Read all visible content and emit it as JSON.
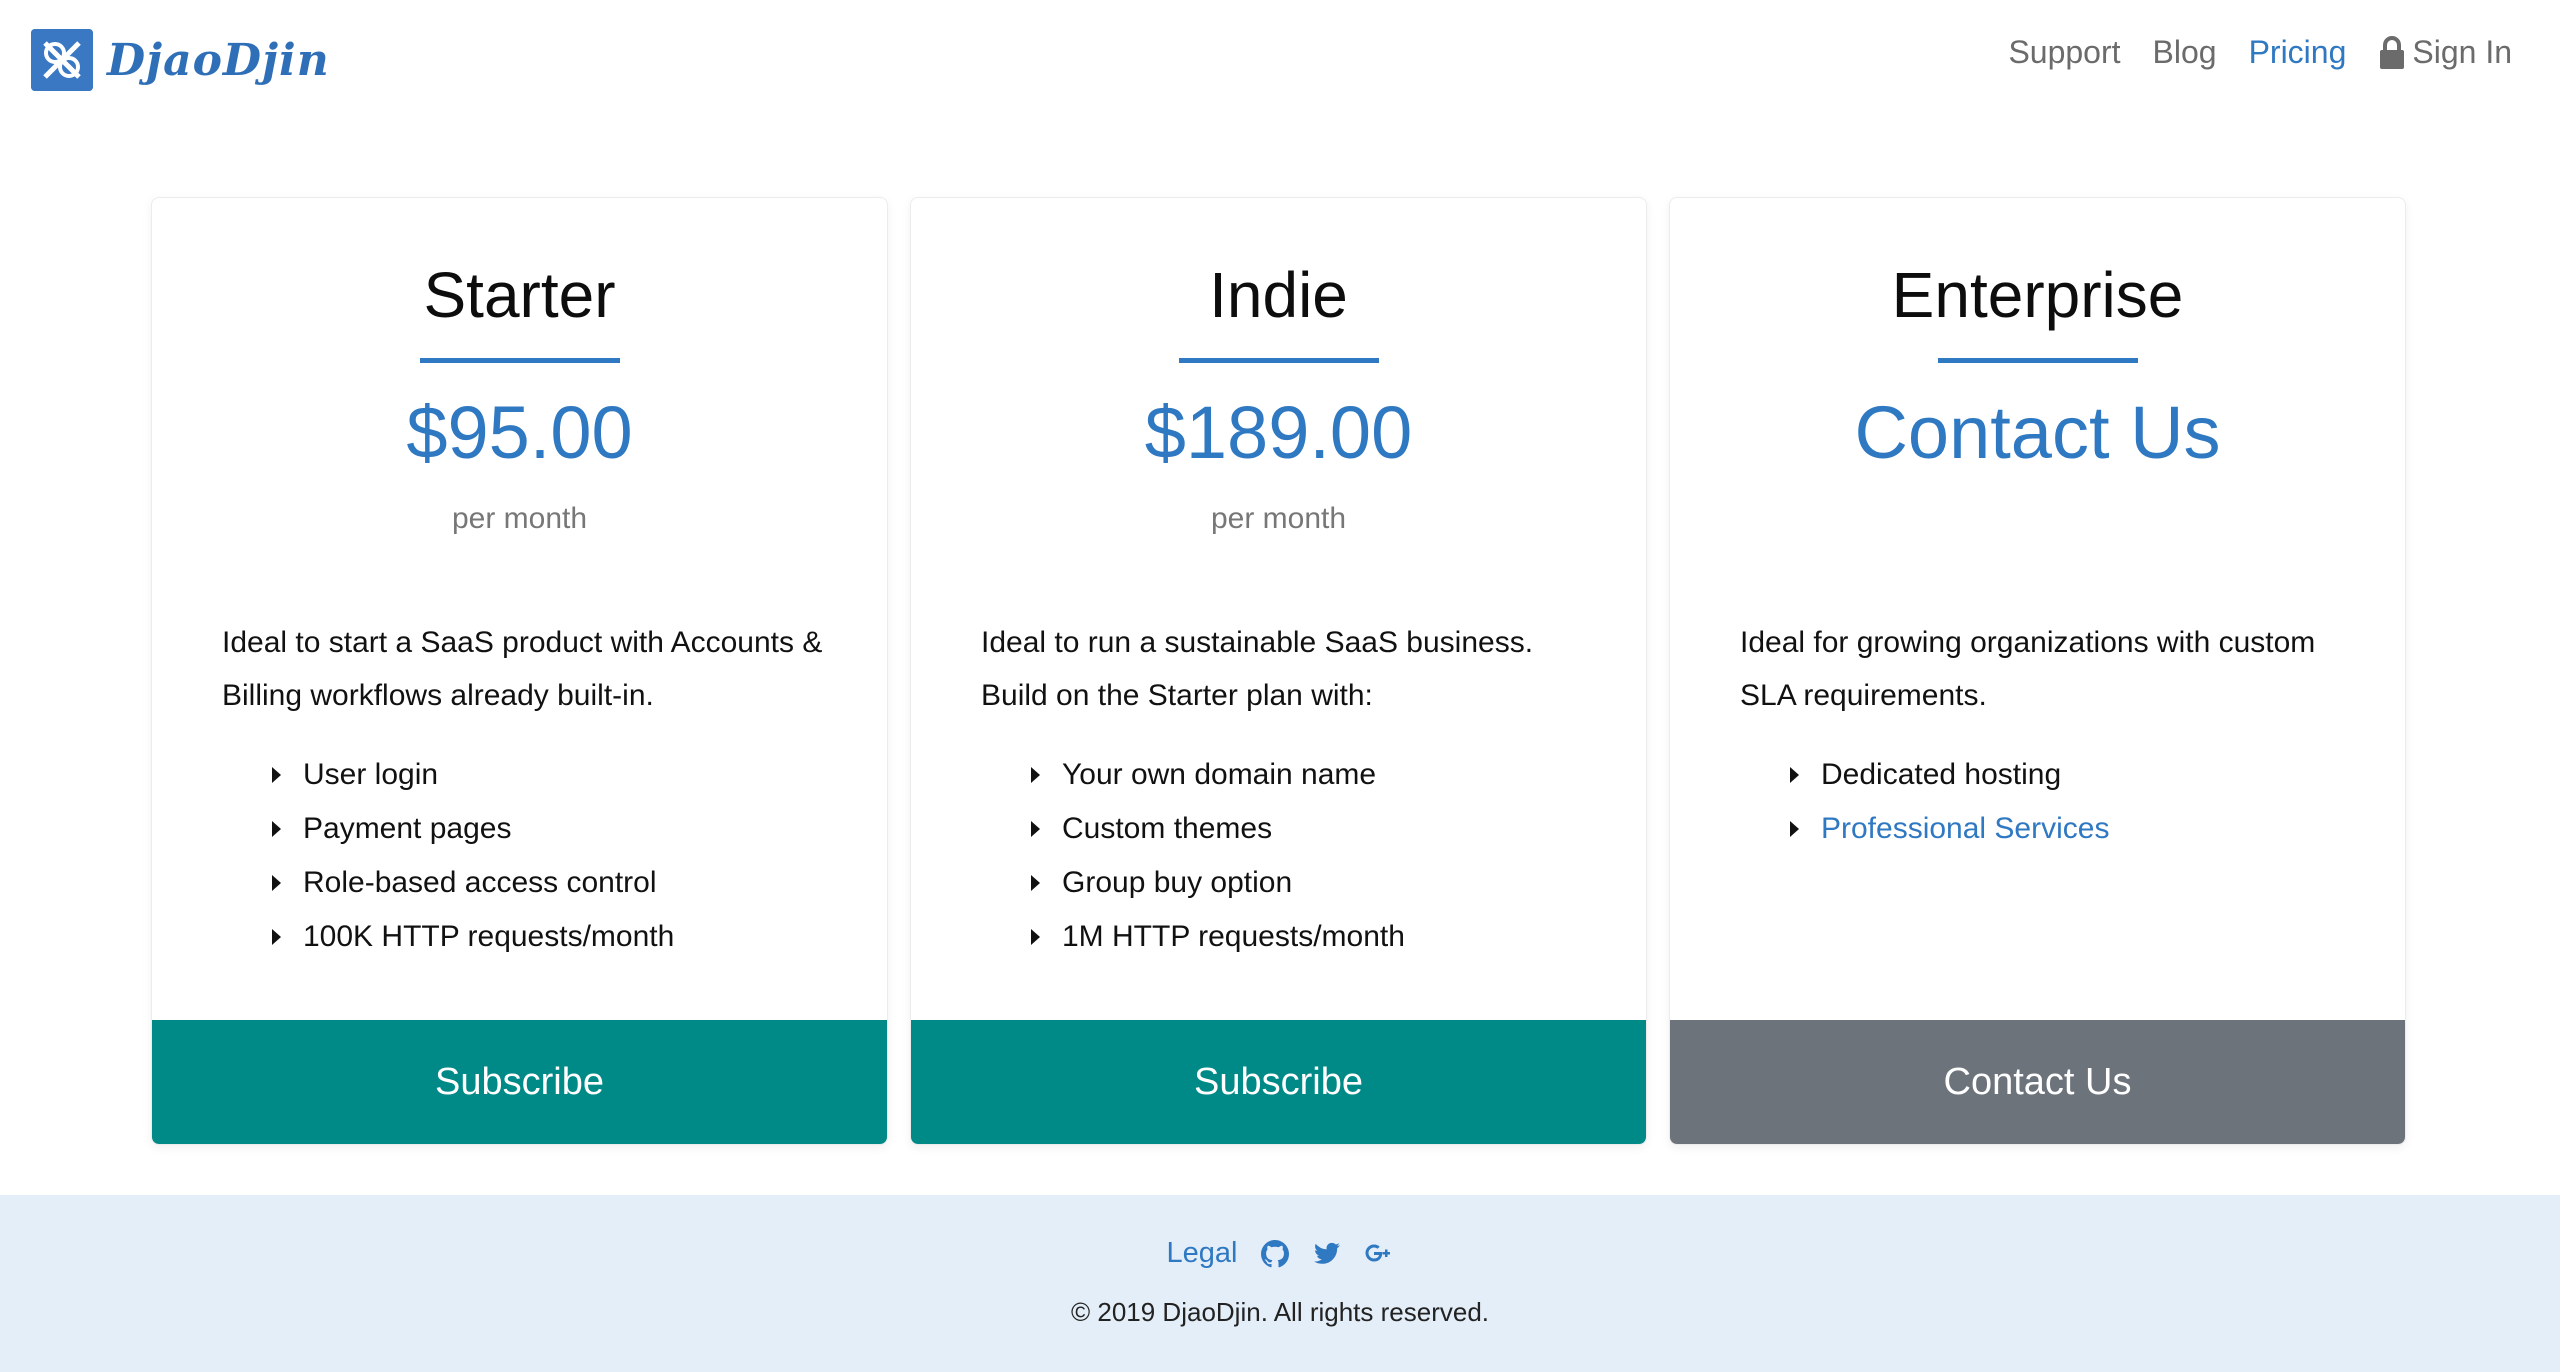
{
  "brand": {
    "name": "DjaoDjin",
    "logo_icon": "djaodjin-logo-icon",
    "color": "#3a78c3"
  },
  "nav": {
    "items": [
      {
        "label": "Support",
        "active": false
      },
      {
        "label": "Blog",
        "active": false
      },
      {
        "label": "Pricing",
        "active": true
      },
      {
        "label": "Sign In",
        "icon": "lock-icon",
        "active": false
      }
    ]
  },
  "plans": [
    {
      "title": "Starter",
      "price": "$95.00",
      "period": "per month",
      "description": "Ideal to start a SaaS product with Accounts & Billing workflows already built-in.",
      "features": [
        "User login",
        "Payment pages",
        "Role-based access control",
        "100K HTTP requests/month"
      ],
      "button": "Subscribe",
      "button_color": "#008a87"
    },
    {
      "title": "Indie",
      "price": "$189.00",
      "period": "per month",
      "description": "Ideal to run a sustainable SaaS business. Build on the Starter plan with:",
      "features": [
        "Your own domain name",
        "Custom themes",
        "Group buy option",
        "1M HTTP requests/month"
      ],
      "button": "Subscribe",
      "button_color": "#008a87"
    },
    {
      "title": "Enterprise",
      "price": "Contact Us",
      "period": "",
      "description": "Ideal for growing organizations with custom SLA requirements.",
      "features": [
        "Dedicated hosting",
        "Professional Services"
      ],
      "button": "Contact Us",
      "button_color": "#6c737b"
    }
  ],
  "footer": {
    "legal": "Legal",
    "social_icons": [
      "github-icon",
      "twitter-icon",
      "google-plus-icon"
    ],
    "copyright": "© 2019 DjaoDjin. All rights reserved.",
    "background": "#e4eef8"
  },
  "colors": {
    "accent": "#2f78c2",
    "teal": "#008a87",
    "gray_button": "#6c737b"
  }
}
